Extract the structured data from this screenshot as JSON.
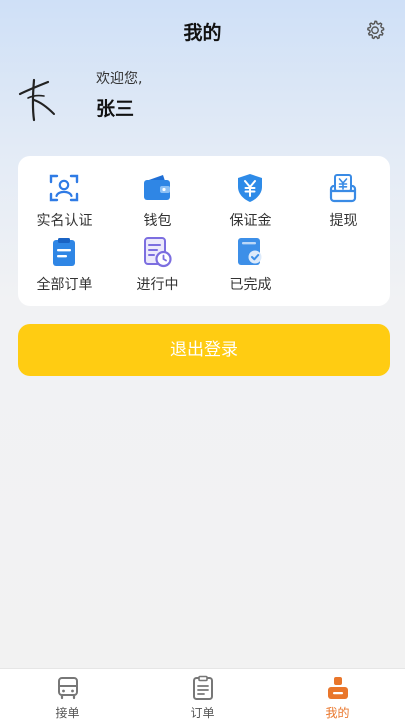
{
  "header": {
    "title": "我的",
    "settings_icon": "gear-icon"
  },
  "profile": {
    "welcome": "欢迎您,",
    "name": "张三",
    "avatar": "handwritten-signature-avatar"
  },
  "menu": [
    {
      "label": "实名认证",
      "icon": "id-scan-icon",
      "color": "#2f7be5"
    },
    {
      "label": "钱包",
      "icon": "wallet-icon",
      "color": "#2f86e5"
    },
    {
      "label": "保证金",
      "icon": "shield-yuan-icon",
      "color": "#2e8be8"
    },
    {
      "label": "提现",
      "icon": "withdraw-icon",
      "color": "#3a8be5"
    },
    {
      "label": "全部订单",
      "icon": "clipboard-icon",
      "color": "#2f86e5"
    },
    {
      "label": "进行中",
      "icon": "document-clock-icon",
      "color": "#7c6ee0"
    },
    {
      "label": "已完成",
      "icon": "document-check-icon",
      "color": "#3d8fe8"
    }
  ],
  "logout_label": "退出登录",
  "tabbar": {
    "items": [
      {
        "label": "接单",
        "icon": "bus-icon",
        "active": false
      },
      {
        "label": "订单",
        "icon": "clipboard-list-icon",
        "active": false
      },
      {
        "label": "我的",
        "icon": "user-profile-icon",
        "active": true
      }
    ],
    "active_color": "#e9762b"
  },
  "colors": {
    "accent_yellow": "#ffcc12",
    "accent_orange": "#e9762b"
  }
}
